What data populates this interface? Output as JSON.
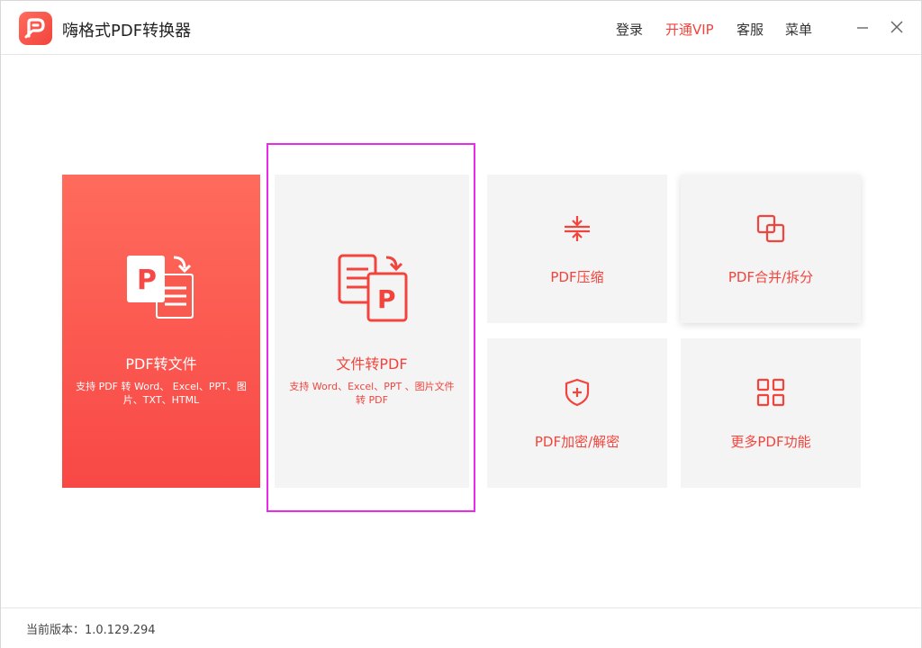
{
  "app": {
    "title": "嗨格式PDF转换器",
    "logo_icon": "pdf-logo-icon",
    "brand_color": "#f2443d"
  },
  "nav": {
    "login": "登录",
    "vip": "开通VIP",
    "service": "客服",
    "menu": "菜单"
  },
  "cards": {
    "pdf_to_file": {
      "title": "PDF转文件",
      "desc": "支持 PDF 转 Word、 Excel、PPT、图片、TXT、HTML",
      "icon": "pdf-to-file-icon"
    },
    "file_to_pdf": {
      "title": "文件转PDF",
      "desc": "支持 Word、Excel、PPT 、图片文件转 PDF",
      "icon": "file-to-pdf-icon"
    },
    "compress": {
      "title": "PDF压缩",
      "icon": "compress-icon"
    },
    "merge_split": {
      "title": "PDF合并/拆分",
      "icon": "merge-icon"
    },
    "encrypt": {
      "title": "PDF加密/解密",
      "icon": "shield-plus-icon"
    },
    "more": {
      "title": "更多PDF功能",
      "icon": "grid-icon"
    }
  },
  "footer": {
    "version": "当前版本：1.0.129.294"
  }
}
